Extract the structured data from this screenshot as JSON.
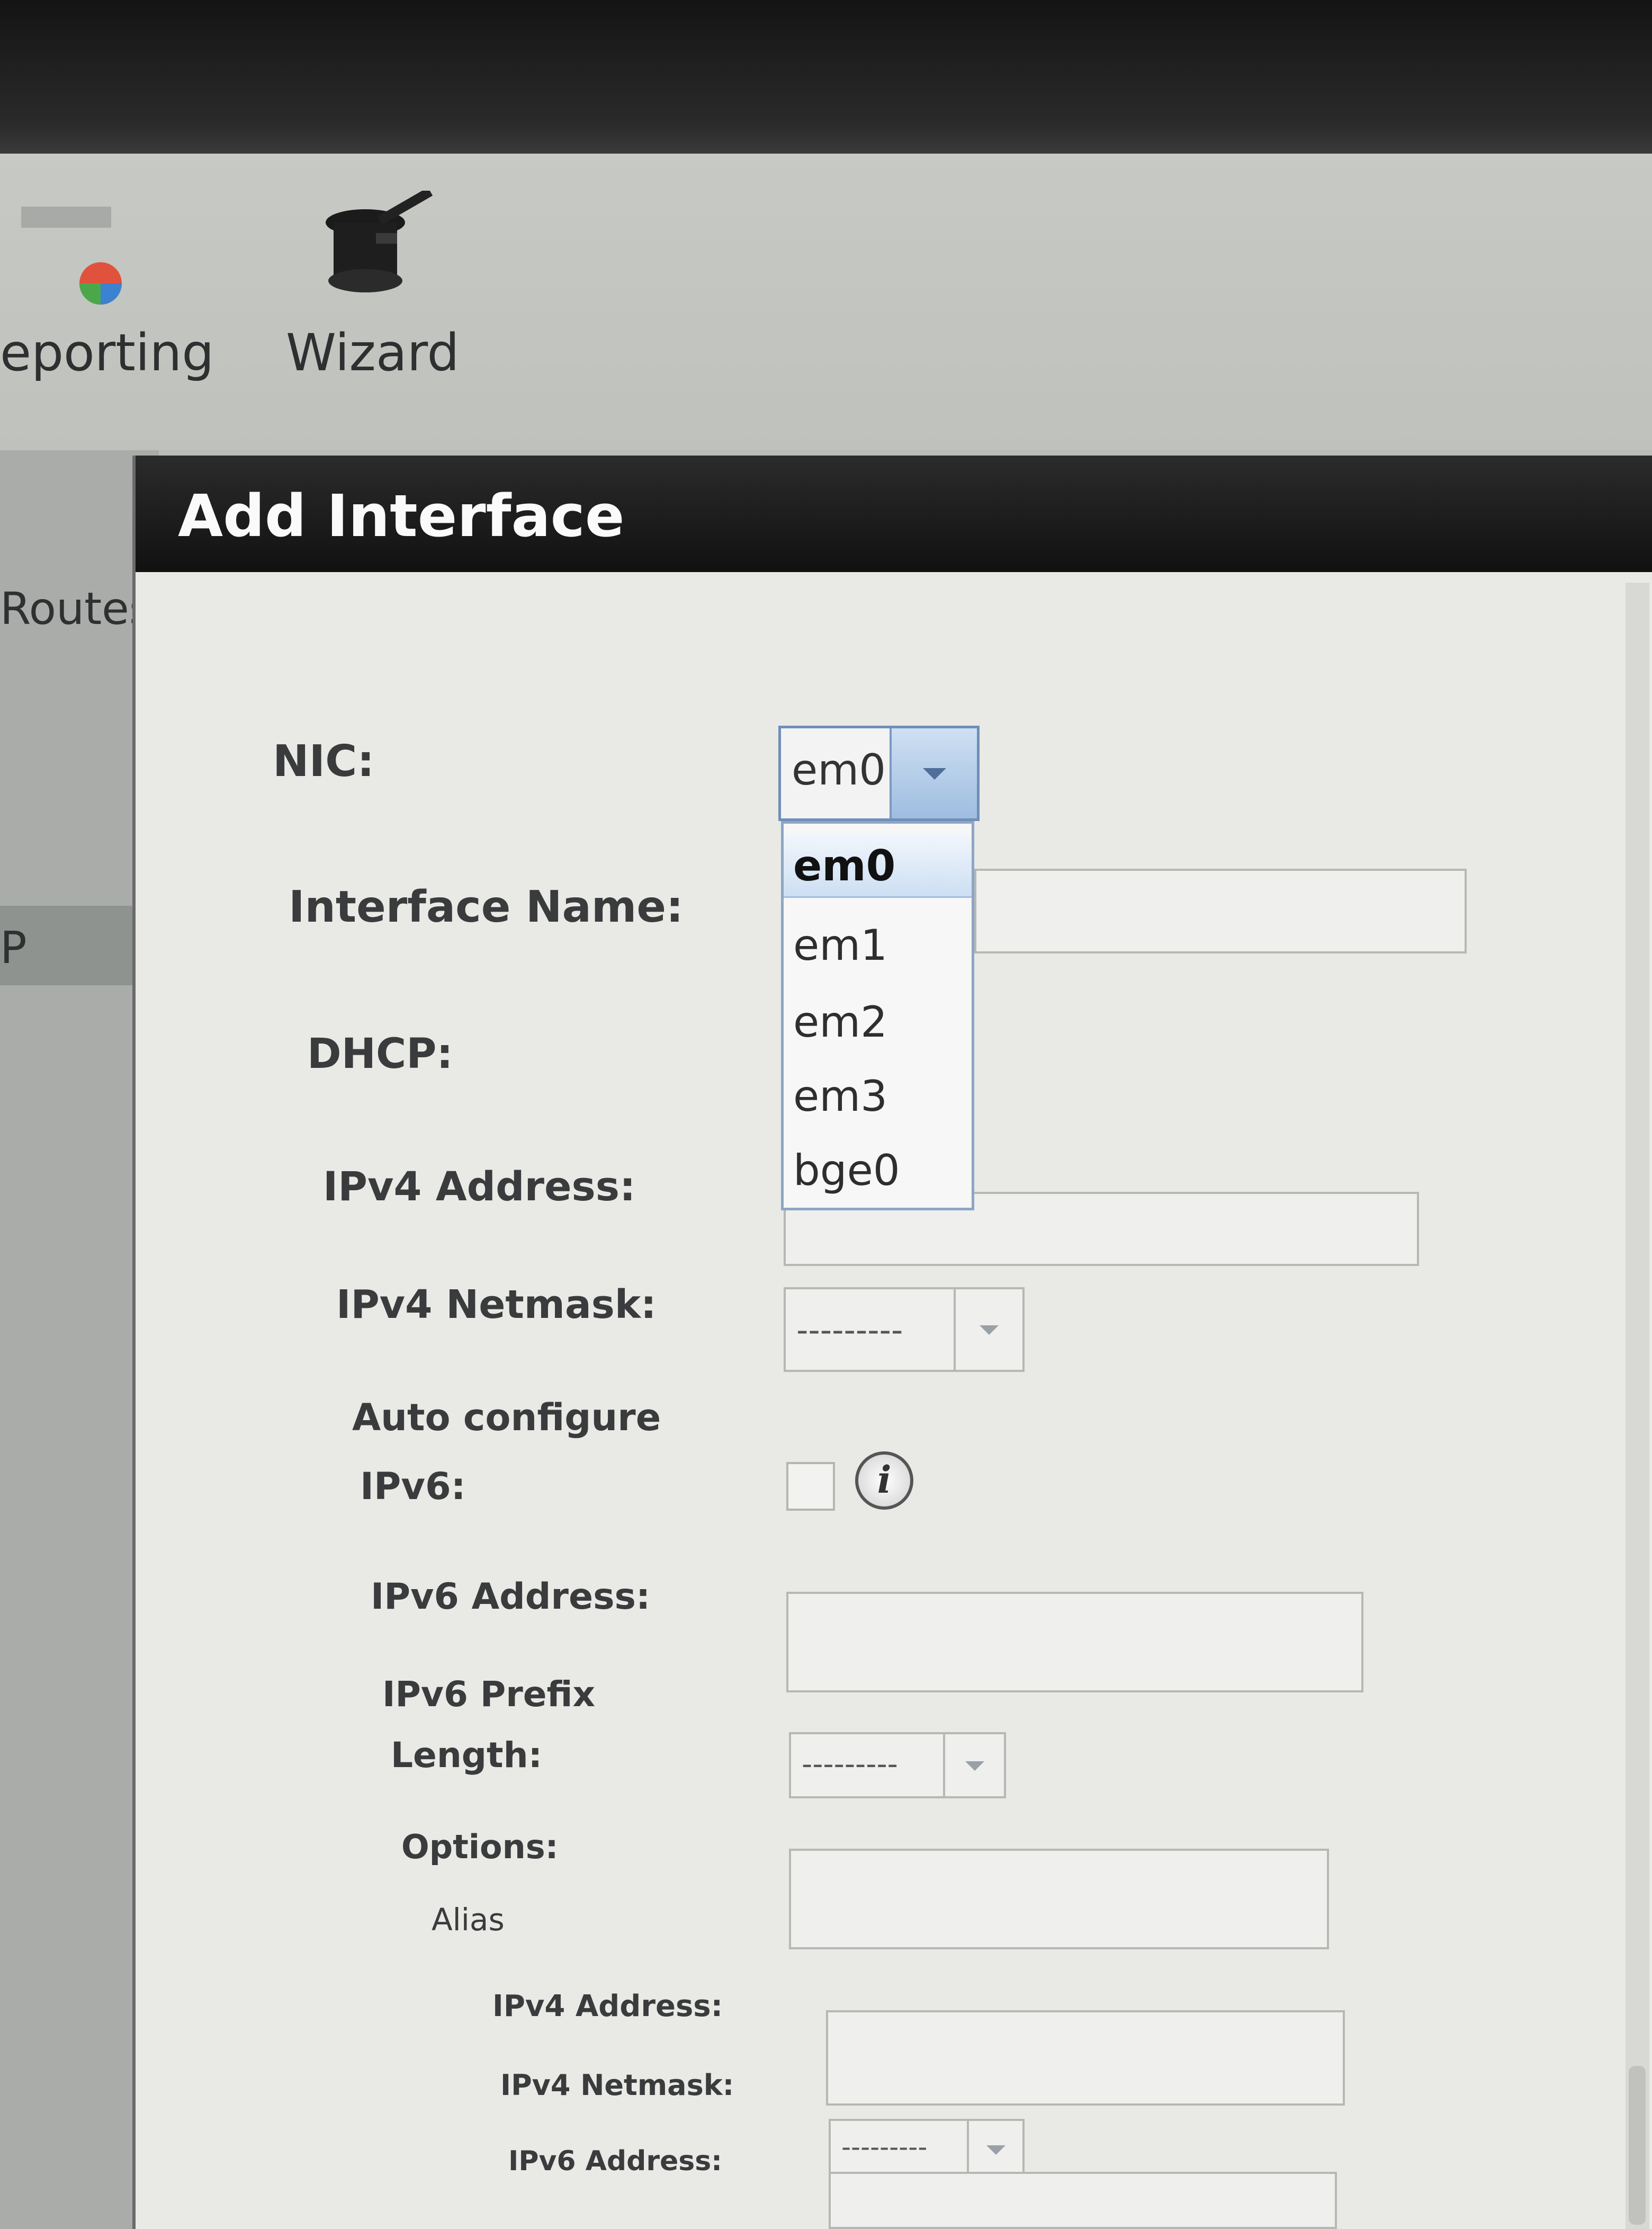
{
  "toolbar": {
    "items": [
      {
        "label": "eporting",
        "icon": "pie-chart-icon"
      },
      {
        "label": "Wizard",
        "icon": "top-hat-wizard-icon"
      }
    ]
  },
  "tabs": {
    "routes_label": "Routes",
    "left_row_label": "P"
  },
  "dialog": {
    "title": "Add Interface",
    "fields": {
      "nic_label": "NIC:",
      "nic_value": "em0",
      "nic_options": [
        "em0",
        "em1",
        "em2",
        "em3",
        "bge0"
      ],
      "interface_name_label": "Interface Name:",
      "dhcp_label": "DHCP:",
      "ipv4_address_label": "IPv4 Address:",
      "ipv4_netmask_label": "IPv4 Netmask:",
      "ipv4_netmask_value": "---------",
      "auto_configure_label_line1": "Auto configure",
      "auto_configure_label_line2": "IPv6:",
      "ipv6_address_label": "IPv6 Address:",
      "ipv6_prefix_label_line1": "IPv6 Prefix",
      "ipv6_prefix_label_line2": "Length:",
      "ipv6_prefix_value": "---------",
      "options_label": "Options:",
      "alias_label": "Alias",
      "alias_ipv4_address_label": "IPv4 Address:",
      "alias_ipv4_netmask_label": "IPv4 Netmask:",
      "alias_ipv4_netmask_value": "---------",
      "alias_ipv6_address_label": "IPv6 Address:"
    }
  }
}
